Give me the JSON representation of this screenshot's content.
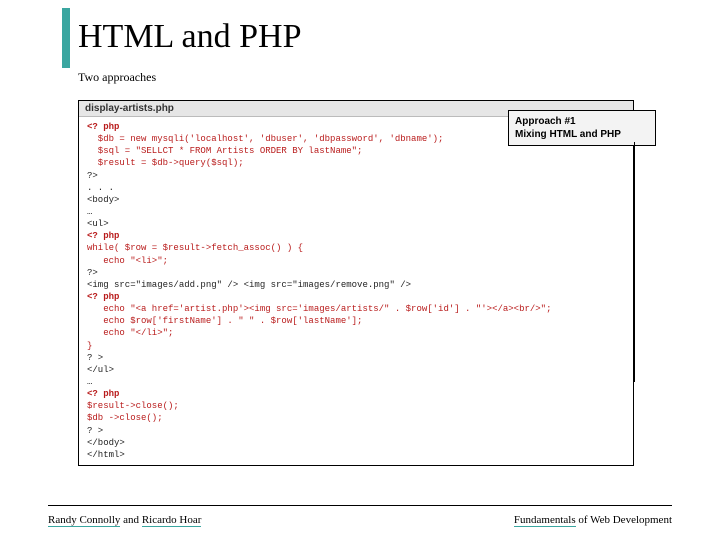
{
  "title": "HTML and PHP",
  "subtitle": "Two approaches",
  "filename": "display-artists.php",
  "callout": {
    "line1": "Approach #1",
    "line2": "Mixing HTML and PHP"
  },
  "code": {
    "l01": "<? php",
    "l02": "  $db = new mysqli('localhost', 'dbuser', 'dbpassword', 'dbname');",
    "l03": "  $sql = \"SELLCT * FROM Artists ORDER BY lastName\";",
    "l04": "  $result = $db->query($sql);",
    "l05": "?>",
    "l06": ". . .",
    "l07": "<body>",
    "l08": "…",
    "l09": "<ul>",
    "l10": "<? php",
    "l11": "while( $row = $result->fetch_assoc() ) {",
    "l12": "   echo \"<li>\";",
    "l13": "?>",
    "l14": "<img src=\"images/add.png\" /> <img src=\"images/remove.png\" />",
    "l15": "<? php",
    "l16": "   echo \"<a href='artist.php'><img src='images/artists/\" . $row['id'] . \"'></a><br/>\";",
    "l17": "   echo $row['firstName'] . \" \" . $row['lastName'];",
    "l18": "   echo \"</li>\";",
    "l19": "}",
    "l20": "? >",
    "l21": "</ul>",
    "l22": "…",
    "l23": "<? php",
    "l24": "$result->close();",
    "l25": "$db ->close();",
    "l26": "? >",
    "l27": "</body>",
    "l28": "</html>"
  },
  "footer": {
    "author1": "Randy Connolly",
    "and": " and ",
    "author2": "Ricardo Hoar",
    "book_word1": "Fundamentals",
    "book_rest": " of Web Development"
  }
}
